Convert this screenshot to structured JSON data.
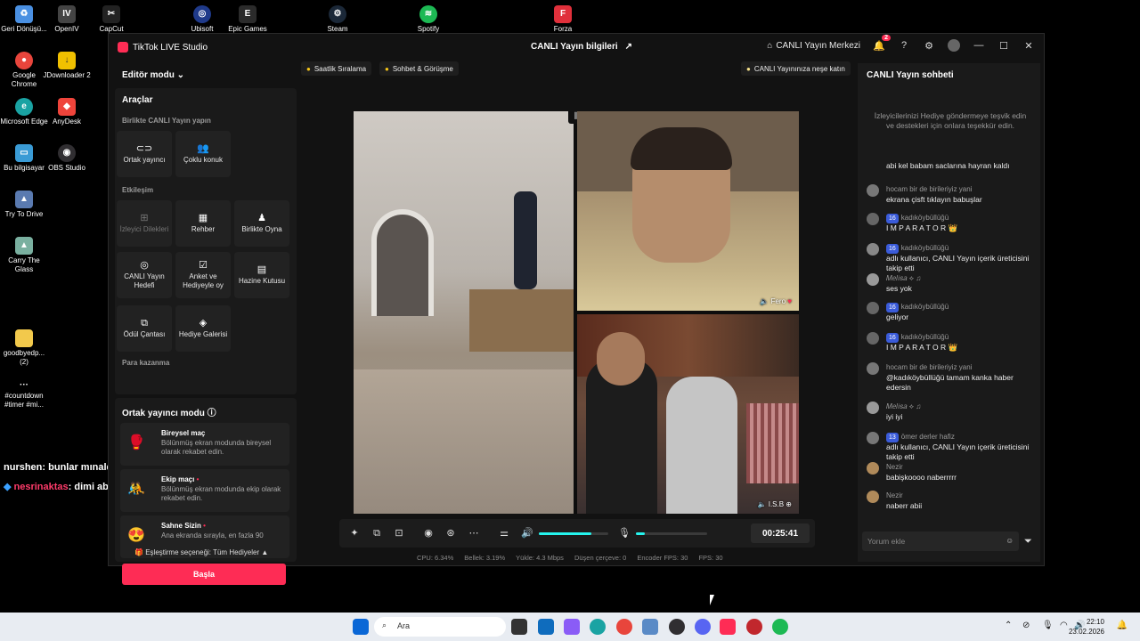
{
  "desktop": {
    "icons": [
      {
        "label": "Geri Dönüşü...",
        "color": "#4a90e2"
      },
      {
        "label": "OpenIV",
        "color": "#444"
      },
      {
        "label": "CapCut",
        "color": "#222"
      },
      {
        "label": "Ubisoft",
        "color": "#1f3a8a"
      },
      {
        "label": "Epic Games",
        "color": "#2b2b2b"
      },
      {
        "label": "Steam",
        "color": "#1b2838"
      },
      {
        "label": "Spotify",
        "color": "#1db954"
      },
      {
        "label": "Forza",
        "color": "#e0303b"
      },
      {
        "label": "Google Chrome",
        "color": "#e8453c"
      },
      {
        "label": "JDownloader 2",
        "color": "#f0c000"
      },
      {
        "label": "Microsoft Edge",
        "color": "#1aa3a3"
      },
      {
        "label": "AnyDesk",
        "color": "#ef443b"
      },
      {
        "label": "Bu bilgisayar",
        "color": "#3a9bd5"
      },
      {
        "label": "OBS Studio",
        "color": "#302e31"
      },
      {
        "label": "Try To Drive",
        "color": "#5a7ab0"
      },
      {
        "label": "Carry The Glass",
        "color": "#7ab0a0"
      },
      {
        "label": "goodbyedp... (2)",
        "color": "#f2c94c"
      },
      {
        "label": "#countdown #timer #mi...",
        "color": "#000"
      }
    ],
    "overlay_chat": [
      {
        "user": "nurshen",
        "text": ": bunlar mınaldklaksls"
      },
      {
        "user": "nesrinaktas",
        "text": ": dimi ablaaar dmmfmgm"
      }
    ]
  },
  "window": {
    "app_title": "TikTok LIVE Studio",
    "center_title": "CANLI Yayın bilgileri",
    "live_center": "CANLI Yayın Merkezi",
    "notif_count": "2"
  },
  "left": {
    "editor_mode": "Editör modu",
    "tools_title": "Araçlar",
    "sec_together": "Birlikte CANLI Yayın yapın",
    "btn_cohost": "Ortak yayıncı",
    "btn_multi": "Çoklu konuk",
    "sec_engage": "Etkileşim",
    "btn_requests": "İzleyici Dilekleri",
    "btn_guide": "Rehber",
    "btn_play": "Birlikte Oyna",
    "btn_goal": "CANLI Yayın Hedefi",
    "btn_poll": "Anket ve Hediyeyle oy",
    "btn_treasure": "Hazine Kutusu",
    "btn_reward": "Ödül Çantası",
    "btn_gallery": "Hediye Galerisi",
    "sec_earn": "Para kazanma",
    "cohost_title": "Ortak yayıncı modu",
    "modes": [
      {
        "title": "Bireysel maç",
        "desc": "Bölünmüş ekran modunda bireysel olarak rekabet edin."
      },
      {
        "title": "Ekip maçı",
        "desc": "Bölünmüş ekran modunda ekip olarak rekabet edin."
      },
      {
        "title": "Sahne Sizin",
        "desc": "Ana ekranda sırayla, en fazla 90"
      }
    ],
    "match_option": "Eşleştirme seçeneği: Tüm Hediyeler",
    "start": "Başla"
  },
  "center": {
    "chip_ranking": "Saatlik Sıralama",
    "chip_chat": "Sohbet & Görüşme",
    "chip_join": "CANLI Yayınınıza neşe katın",
    "guest1_name": "Fero",
    "guest2_name": "I.S.B",
    "timer": "00:25:41",
    "speaker_level": 0.75,
    "mic_level": 0.12,
    "stats": {
      "cpu": "CPU:  6.34%",
      "mem": "Bellek:  3.19%",
      "upload": "Yükle:  4.3 Mbps",
      "drop": "Düşen çerçeve:  0",
      "encoder": "Encoder FPS:  30",
      "fps": "FPS:  30"
    }
  },
  "right": {
    "title": "CANLI Yayın sohbeti",
    "gift_tip": "İzleyicilerinizi Hediye göndermeye teşvik edin ve destekleri için onlara teşekkür edin.",
    "messages": [
      {
        "user": "",
        "badge": "",
        "text": "abi kel babam saclarına hayran kaldı"
      },
      {
        "user": "hocam bir de birileriyiz yani",
        "badge": "",
        "text": "ekrana çisft tıklayın babuşlar"
      },
      {
        "user": "kadıköybüllüğü",
        "badge": "16",
        "text": "I M P A R A T O R 👑"
      },
      {
        "user": "kadıköybüllüğü",
        "badge": "16",
        "text": "adlı kullanıcı, CANLI Yayın içerik üreticisini takip etti"
      },
      {
        "user": "𝑀𝑒𝑙𝑖𝑠𝑎 ⟡ ♫",
        "badge": "",
        "text": "ses yok"
      },
      {
        "user": "kadıköybüllüğü",
        "badge": "16",
        "text": "geliyor"
      },
      {
        "user": "kadıköybüllüğü",
        "badge": "16",
        "text": "I M P A R A T O R 👑"
      },
      {
        "user": "hocam bir de birileriyiz yani",
        "badge": "",
        "text": "@kadıköybüllüğü tamam kanka haber edersin"
      },
      {
        "user": "𝑀𝑒𝑙𝑖𝑠𝑎 ⟡ ♫",
        "badge": "",
        "text": "iyi iyi"
      },
      {
        "user": "ömer derler hafiz",
        "badge": "13",
        "text": "adlı kullanıcı, CANLI Yayın içerik üreticisini takip etti"
      },
      {
        "user": "Nezir",
        "badge": "",
        "text": "babişkoooo naberrrrr"
      },
      {
        "user": "Nezir",
        "badge": "",
        "text": "naberr abii"
      }
    ],
    "comment_placeholder": "Yorum ekle"
  },
  "taskbar": {
    "search": "Ara",
    "time": "22:10",
    "date": "23.02.2026"
  }
}
